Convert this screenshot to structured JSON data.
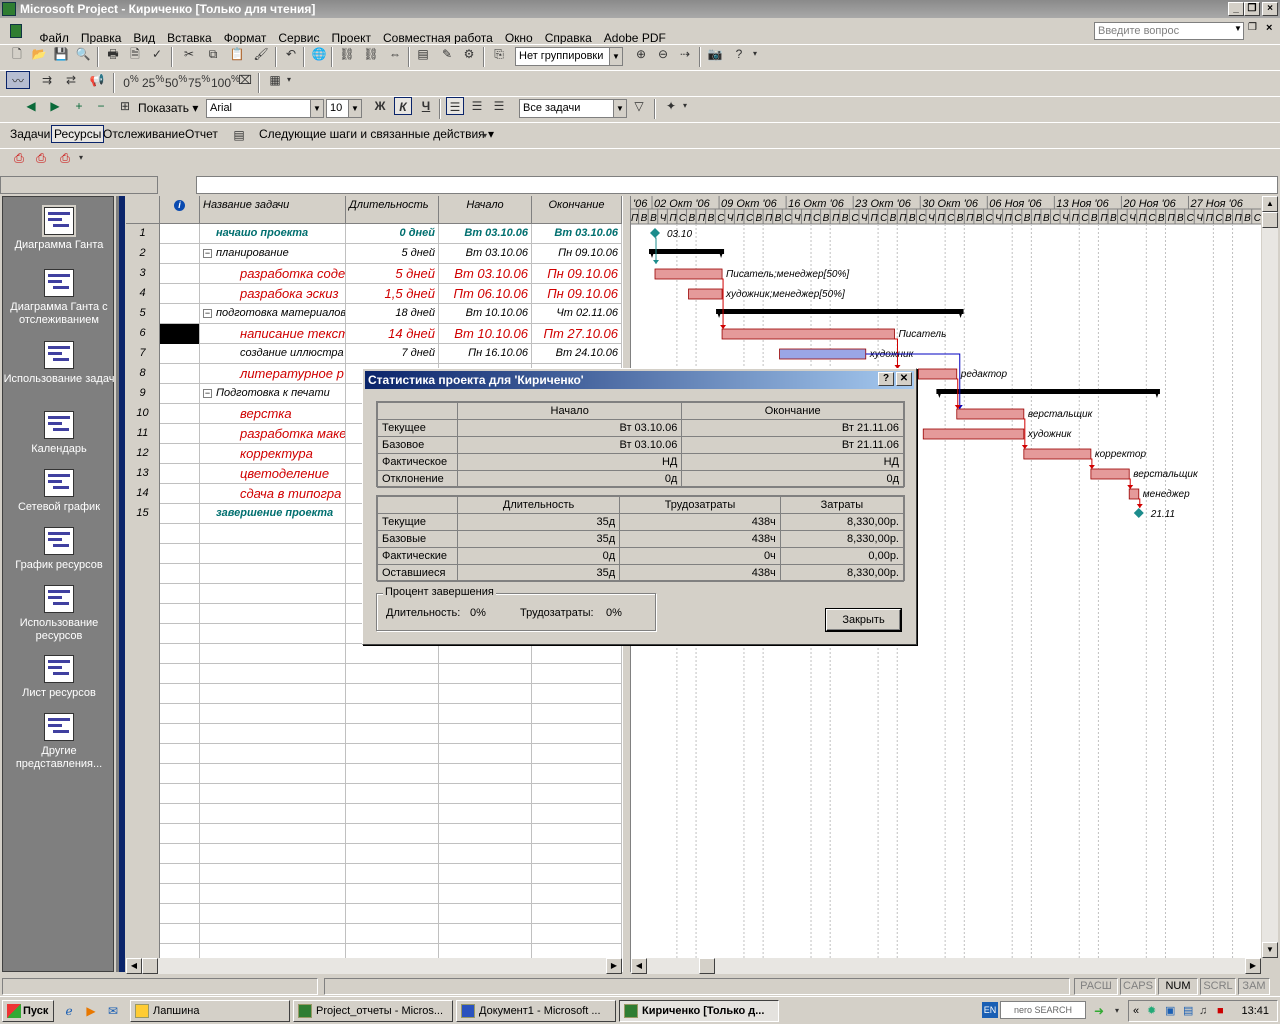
{
  "window": {
    "title": "Microsoft Project - Кириченко [Только для чтения]"
  },
  "menu": [
    "Файл",
    "Правка",
    "Вид",
    "Вставка",
    "Формат",
    "Сервис",
    "Проект",
    "Совместная работа",
    "Окно",
    "Справка",
    "Adobe PDF"
  ],
  "help_placeholder": "Введите вопрос",
  "toolbar": {
    "grouping": "Нет группировки",
    "zoom_levels": [
      "0",
      "25",
      "50",
      "75",
      "100"
    ],
    "show_label": "Показать",
    "font": "Arial",
    "font_size": "10",
    "bold": "Ж",
    "italic": "К",
    "underline": "Ч",
    "filter": "Все задачи"
  },
  "guide": {
    "items": [
      "Задачи",
      "Ресурсы",
      "Отслеживание",
      "Отчет"
    ],
    "next_steps": "Следующие шаги и связанные действия"
  },
  "viewbar": [
    {
      "label": "Диаграмма Ганта",
      "active": true
    },
    {
      "label": "Диаграмма Ганта с отслеживанием"
    },
    {
      "label": "Использование задач"
    },
    {
      "label": "Календарь"
    },
    {
      "label": "Сетевой график"
    },
    {
      "label": "График ресурсов"
    },
    {
      "label": "Использование ресурсов"
    },
    {
      "label": "Лист ресурсов"
    },
    {
      "label": "Другие представления..."
    }
  ],
  "table": {
    "headers": {
      "info": "i",
      "name": "Название задачи",
      "duration": "Длительность",
      "start": "Начало",
      "finish": "Окончание"
    },
    "rows": [
      {
        "id": "1",
        "name": "начашо проекта",
        "duration": "0 дней",
        "start": "Вт 03.10.06",
        "finish": "Вт 03.10.06",
        "type": "milestone"
      },
      {
        "id": "2",
        "name": "планирование",
        "duration": "5 дней",
        "start": "Вт 03.10.06",
        "finish": "Пн 09.10.06",
        "type": "summary"
      },
      {
        "id": "3",
        "name": "разработка соде",
        "duration": "5 дней",
        "start": "Вт 03.10.06",
        "finish": "Пн 09.10.06",
        "type": "critical"
      },
      {
        "id": "4",
        "name": "разрабока эскиз",
        "duration": "1,5 дней",
        "start": "Пт 06.10.06",
        "finish": "Пн 09.10.06",
        "type": "critical"
      },
      {
        "id": "5",
        "name": "подготовка материалов",
        "duration": "18 дней",
        "start": "Вт 10.10.06",
        "finish": "Чт 02.11.06",
        "type": "summary"
      },
      {
        "id": "6",
        "name": "написание текст",
        "duration": "14 дней",
        "start": "Вт 10.10.06",
        "finish": "Пт 27.10.06",
        "type": "critical"
      },
      {
        "id": "7",
        "name": "создание иллюстра",
        "duration": "7 дней",
        "start": "Пн 16.10.06",
        "finish": "Вт 24.10.06",
        "type": "normal"
      },
      {
        "id": "8",
        "name": "литературное р",
        "duration": "",
        "start": "",
        "finish": "",
        "type": "critical"
      },
      {
        "id": "9",
        "name": "Подготовка к печати",
        "duration": "",
        "start": "",
        "finish": "",
        "type": "summary"
      },
      {
        "id": "10",
        "name": "верстка",
        "duration": "",
        "start": "",
        "finish": "",
        "type": "critical"
      },
      {
        "id": "11",
        "name": "разработка маке",
        "duration": "",
        "start": "",
        "finish": "",
        "type": "critical"
      },
      {
        "id": "12",
        "name": "корректура",
        "duration": "",
        "start": "",
        "finish": "",
        "type": "critical"
      },
      {
        "id": "13",
        "name": "цветоделение",
        "duration": "",
        "start": "",
        "finish": "",
        "type": "critical"
      },
      {
        "id": "14",
        "name": "сдача в типогра",
        "duration": "",
        "start": "",
        "finish": "",
        "type": "critical"
      },
      {
        "id": "15",
        "name": "завершение проекта",
        "duration": "",
        "start": "",
        "finish": "",
        "type": "milestone"
      }
    ]
  },
  "gantt": {
    "weeks": [
      "'06",
      "02 Окт '06",
      "09 Окт '06",
      "16 Окт '06",
      "23 Окт '06",
      "30 Окт '06",
      "06 Ноя '06",
      "13 Ноя '06",
      "20 Ноя '06",
      "27 Ноя '06"
    ],
    "day_letters": [
      "П",
      "В",
      "В",
      "Ч",
      "П",
      "С",
      "В",
      "П",
      "В",
      "С",
      "Ч",
      "П",
      "С",
      "В",
      "П",
      "В",
      "С",
      "Ч",
      "П",
      "С",
      "В",
      "П",
      "В",
      "С",
      "Ч",
      "П",
      "С",
      "В",
      "П",
      "В",
      "С",
      "Ч",
      "П",
      "С",
      "В",
      "П",
      "В",
      "С",
      "Ч",
      "П",
      "С",
      "В",
      "П",
      "В",
      "С",
      "Ч",
      "П",
      "С",
      "В",
      "П",
      "В",
      "С",
      "Ч",
      "П",
      "С",
      "В",
      "П",
      "В",
      "С",
      "Ч",
      "П",
      "С",
      "В",
      "П",
      "В",
      "С"
    ],
    "labels": {
      "m1": "03.10",
      "t3": "Писатель;менеджер[50%]",
      "t4": "художник;менеджер[50%]",
      "t6": "Писатель",
      "t7": "художник",
      "t8": "редактор",
      "t10": "верстальщик",
      "t11": "художник",
      "t12": "корректор",
      "t13": "верстальщик",
      "t14": "менеджер",
      "m15": "21.11"
    }
  },
  "dialog": {
    "title": "Статистика проекта для 'Кириченко'",
    "help": "?",
    "close_x": "✕",
    "dates": {
      "headers": [
        "",
        "Начало",
        "Окончание"
      ],
      "rows": [
        [
          "Текущее",
          "Вт 03.10.06",
          "Вт 21.11.06"
        ],
        [
          "Базовое",
          "Вт 03.10.06",
          "Вт 21.11.06"
        ],
        [
          "Фактическое",
          "НД",
          "НД"
        ],
        [
          "Отклонение",
          "0д",
          "0д"
        ]
      ]
    },
    "totals": {
      "headers": [
        "",
        "Длительность",
        "Трудозатраты",
        "Затраты"
      ],
      "rows": [
        [
          "Текущие",
          "35д",
          "438ч",
          "8,330,00р."
        ],
        [
          "Базовые",
          "35д",
          "438ч",
          "8,330,00р."
        ],
        [
          "Фактические",
          "0д",
          "0ч",
          "0,00р."
        ],
        [
          "Оставшиеся",
          "35д",
          "438ч",
          "8,330,00р."
        ]
      ]
    },
    "percent": {
      "title": "Процент завершения",
      "duration_label": "Длительность:",
      "duration_value": "0%",
      "work_label": "Трудозатраты:",
      "work_value": "0%"
    },
    "close_button": "Закрыть"
  },
  "status": [
    "РАСШ",
    "CAPS",
    "NUM",
    "SCRL",
    "ЗАМ"
  ],
  "taskbar": {
    "start": "Пуск",
    "tasks": [
      {
        "label": "Лапшина"
      },
      {
        "label": "Project_отчеты - Micros..."
      },
      {
        "label": "Документ1 - Microsoft ..."
      },
      {
        "label": "Кириченко [Только д...",
        "active": true
      }
    ],
    "lang": "EN",
    "search": "nero SEARCH",
    "clock": "13:41"
  },
  "colors": {
    "critical": "#d00000",
    "milestone": "#006f6f",
    "bar_critical": "#e59a9a",
    "bar_normal": "#9aa6e6"
  }
}
